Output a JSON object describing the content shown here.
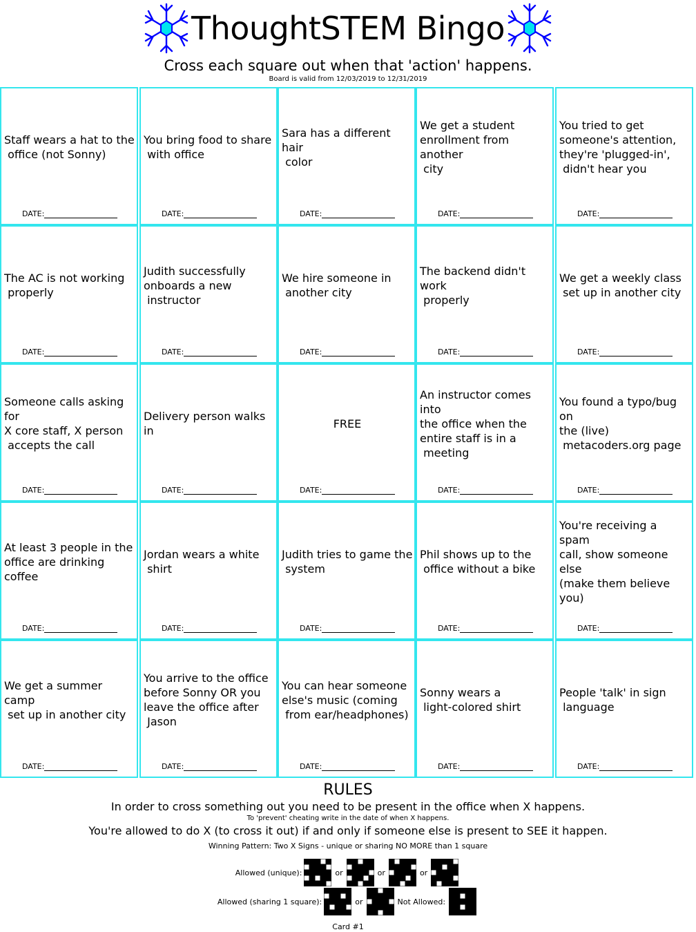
{
  "header": {
    "title": "ThoughtSTEM Bingo",
    "subtitle": "Cross each square out when that 'action' happens.",
    "valid": "Board is valid from 12/03/2019 to 12/31/2019",
    "icon_left": "snowflake-icon",
    "icon_right": "snowflake-icon"
  },
  "date_label": "DATE:",
  "cells": [
    "Staff wears a hat to the\n office (not Sonny)",
    "You bring food to share\n with office",
    "Sara has a different hair\n color",
    "We get a student\nenrollment from another\n city",
    "You tried to get\nsomeone's attention,\nthey're 'plugged-in',\n didn't hear you",
    "The AC is not working\n properly",
    "Judith successfully\nonboards a new\n instructor",
    "We hire someone in\n another city",
    "The backend didn't work\n properly",
    "We get a weekly class\n set up in another city",
    "Someone calls asking for\nX core staff, X person\n accepts the call",
    "Delivery person walks in",
    "FREE",
    "An instructor comes into\nthe office when the\nentire staff is in a\n meeting",
    "You found a typo/bug on\nthe (live)\n metacoders.org page",
    "At least 3 people in the\noffice are drinking coffee",
    "Jordan wears a white\n shirt",
    "Judith tries to game the\n system",
    "Phil shows up to the\n office without a bike",
    "You're receiving a spam\ncall, show someone else\n(make them believe you)",
    "We get a summer camp\n set up in another city",
    "You arrive to the office\nbefore Sonny OR you\nleave the office after\n Jason",
    "You can hear someone\nelse's music (coming\n from ear/headphones)",
    "Sonny wears a\n light-colored shirt",
    "People 'talk' in sign\n language"
  ],
  "rules": {
    "title": "RULES",
    "line1": "In order to cross something out you need to be present in the office when X happens.",
    "line2": "To 'prevent' cheating write in the date of when X happens.",
    "line3": "You're allowed to do X (to cross it out) if and only if someone else is present to SEE it happen.",
    "winning": "Winning Pattern: Two X Signs - unique or sharing NO MORE than 1 square",
    "allowed_unique": "Allowed (unique):",
    "allowed_sharing": "Allowed (sharing 1 square):",
    "not_allowed": "Not Allowed:",
    "or": "or"
  },
  "card": "Card #1",
  "colors": {
    "border": "#33e6ee",
    "flake": "#0000ff",
    "flake_center": "#00e5ee"
  }
}
